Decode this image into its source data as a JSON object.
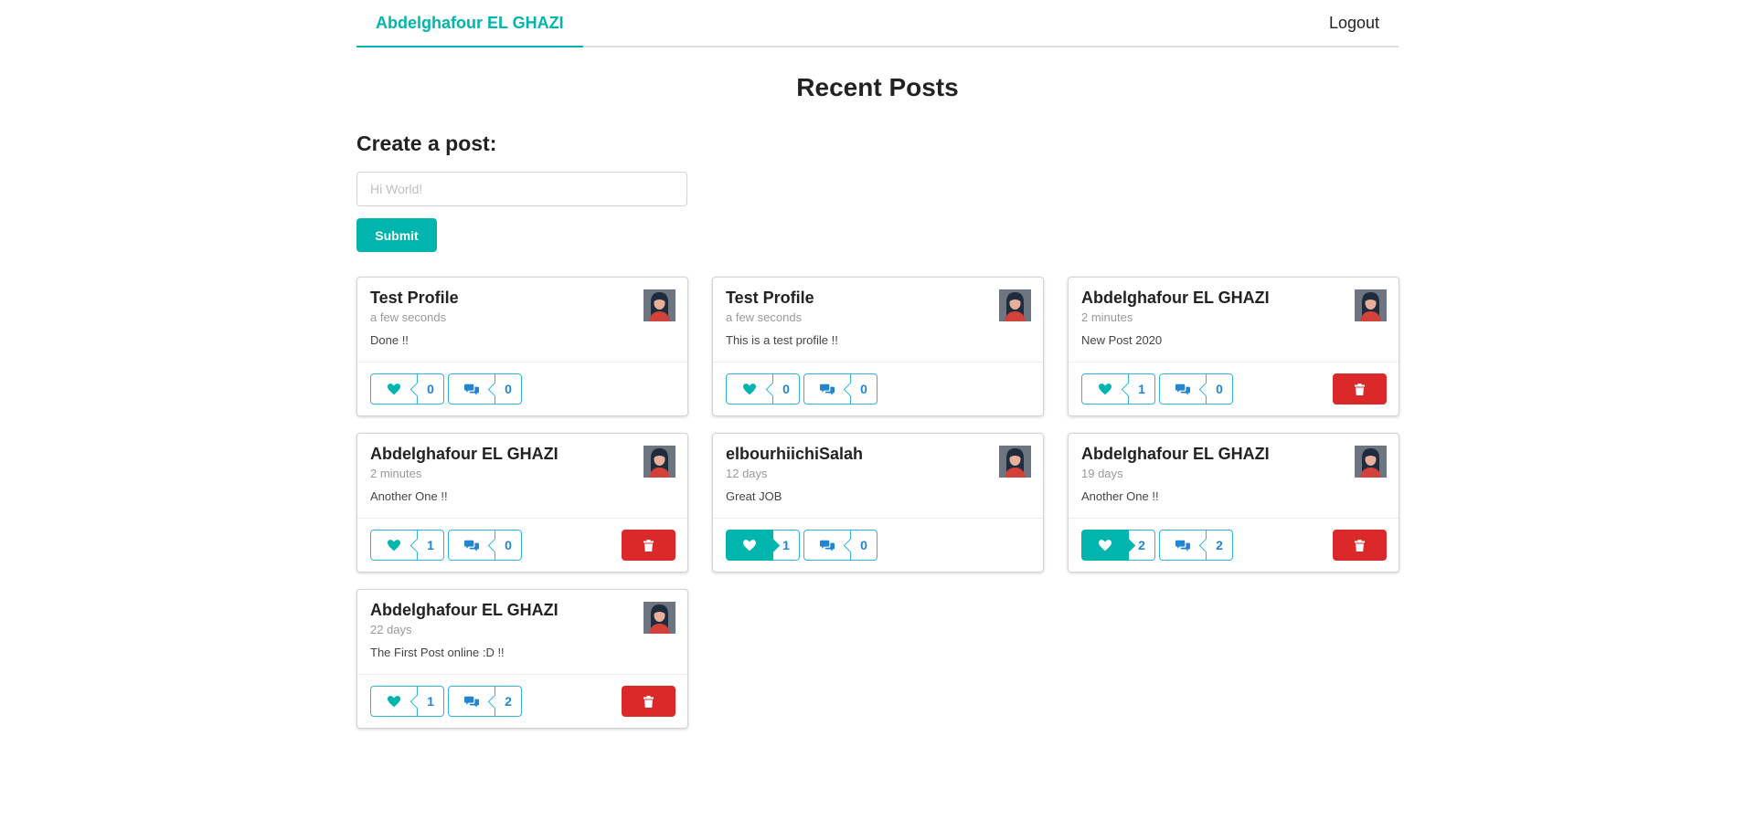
{
  "nav": {
    "user_name": "Abdelghafour EL GHAZI",
    "logout_label": "Logout"
  },
  "page": {
    "title": "Recent Posts"
  },
  "create_form": {
    "heading": "Create a post:",
    "placeholder": "Hi World!",
    "submit_label": "Submit"
  },
  "colors": {
    "teal": "#00b5ad",
    "red": "#db2828",
    "blue": "#2185d0"
  },
  "posts": [
    {
      "author": "Test Profile",
      "time": "a few seconds",
      "body": "Done !!",
      "likes": "0",
      "comments": "0",
      "liked": false,
      "deletable": false
    },
    {
      "author": "Test Profile",
      "time": "a few seconds",
      "body": "This is a test profile !!",
      "likes": "0",
      "comments": "0",
      "liked": false,
      "deletable": false
    },
    {
      "author": "Abdelghafour EL GHAZI",
      "time": "2 minutes",
      "body": "New Post 2020",
      "likes": "1",
      "comments": "0",
      "liked": false,
      "deletable": true
    },
    {
      "author": "Abdelghafour EL GHAZI",
      "time": "2 minutes",
      "body": "Another One !!",
      "likes": "1",
      "comments": "0",
      "liked": false,
      "deletable": true
    },
    {
      "author": "elbourhiichiSalah",
      "time": "12 days",
      "body": "Great JOB",
      "likes": "1",
      "comments": "0",
      "liked": true,
      "deletable": false
    },
    {
      "author": "Abdelghafour EL GHAZI",
      "time": "19 days",
      "body": "Another One !!",
      "likes": "2",
      "comments": "2",
      "liked": true,
      "deletable": true
    },
    {
      "author": "Abdelghafour EL GHAZI",
      "time": "22 days",
      "body": "The First Post online :D !!",
      "likes": "1",
      "comments": "2",
      "liked": false,
      "deletable": true
    }
  ]
}
